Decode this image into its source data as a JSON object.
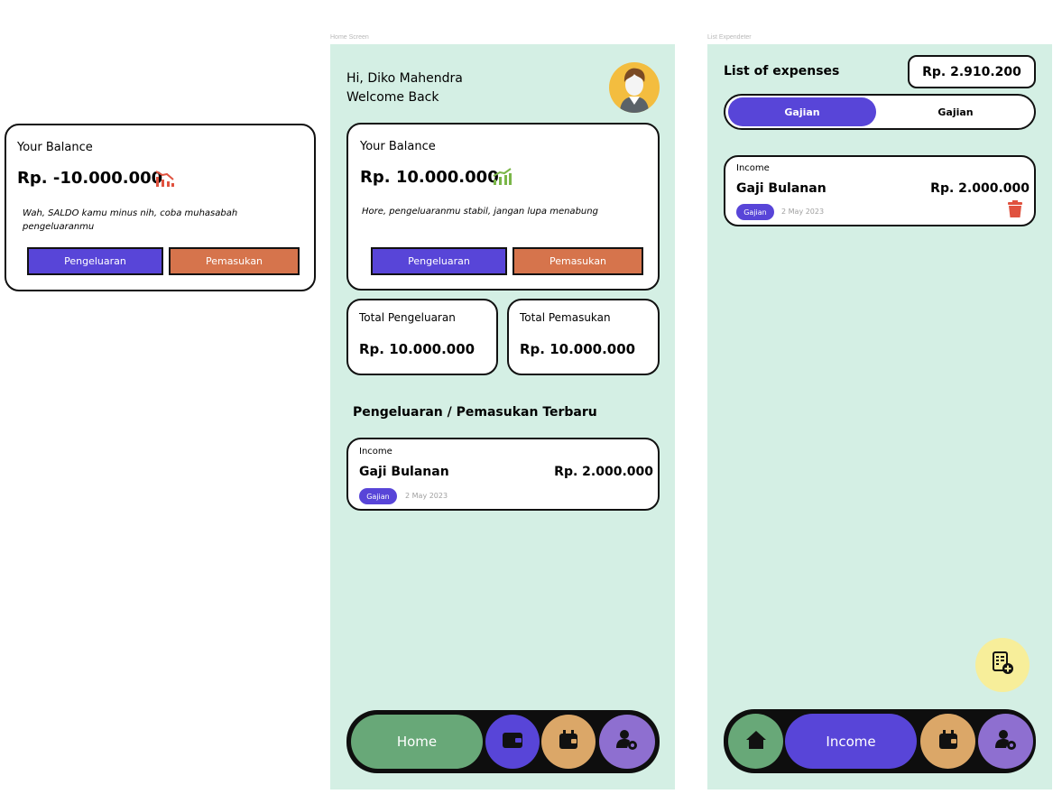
{
  "frames": {
    "home_label": "Home Screen",
    "list_label": "List Expendeter"
  },
  "balance_variant": {
    "title": "Your Balance",
    "amount": "Rp. -10.000.000",
    "message": "Wah, SALDO kamu minus nih, coba muhasabah pengeluaranmu",
    "btn_expense": "Pengeluaran",
    "btn_income": "Pemasukan",
    "trend_color": "#e0523f"
  },
  "home": {
    "greeting": "Hi, Diko Mahendra",
    "welcome": "Welcome Back",
    "balance": {
      "title": "Your Balance",
      "amount": "Rp. 10.000.000",
      "message": "Hore, pengeluaranmu stabil, jangan lupa menabung",
      "btn_expense": "Pengeluaran",
      "btn_income": "Pemasukan",
      "trend_color": "#7ab648"
    },
    "total_expense": {
      "label": "Total Pengeluaran",
      "amount": "Rp. 10.000.000"
    },
    "total_income": {
      "label": "Total Pemasukan",
      "amount": "Rp. 10.000.000"
    },
    "recent_title": "Pengeluaran / Pemasukan Terbaru",
    "recent_item": {
      "type": "Income",
      "name": "Gaji Bulanan",
      "amount": "Rp. 2.000.000",
      "tag": "Gajian",
      "date": "2 May 2023"
    },
    "nav": {
      "active_label": "Home"
    }
  },
  "list": {
    "title": "List of expenses",
    "total": "Rp. 2.910.200",
    "toggle": {
      "active": "Gajian",
      "inactive": "Gajian"
    },
    "item": {
      "type": "Income",
      "name": "Gaji Bulanan",
      "amount": "Rp. 2.000.000",
      "tag": "Gajian",
      "date": "2 May 2023"
    },
    "nav": {
      "active_label": "Income"
    }
  },
  "colors": {
    "screen_bg": "#d4efe4",
    "blue": "#5845d8",
    "orange": "#d6744c",
    "green": "#68a878",
    "tan": "#dba768",
    "purple": "#8e6fd0",
    "fab": "#f7ee9a"
  },
  "icons": [
    "trend-down-icon",
    "trend-up-icon",
    "wallet-icon",
    "calendar-wallet-icon",
    "user-settings-icon",
    "home-icon",
    "trash-icon",
    "add-report-icon"
  ]
}
